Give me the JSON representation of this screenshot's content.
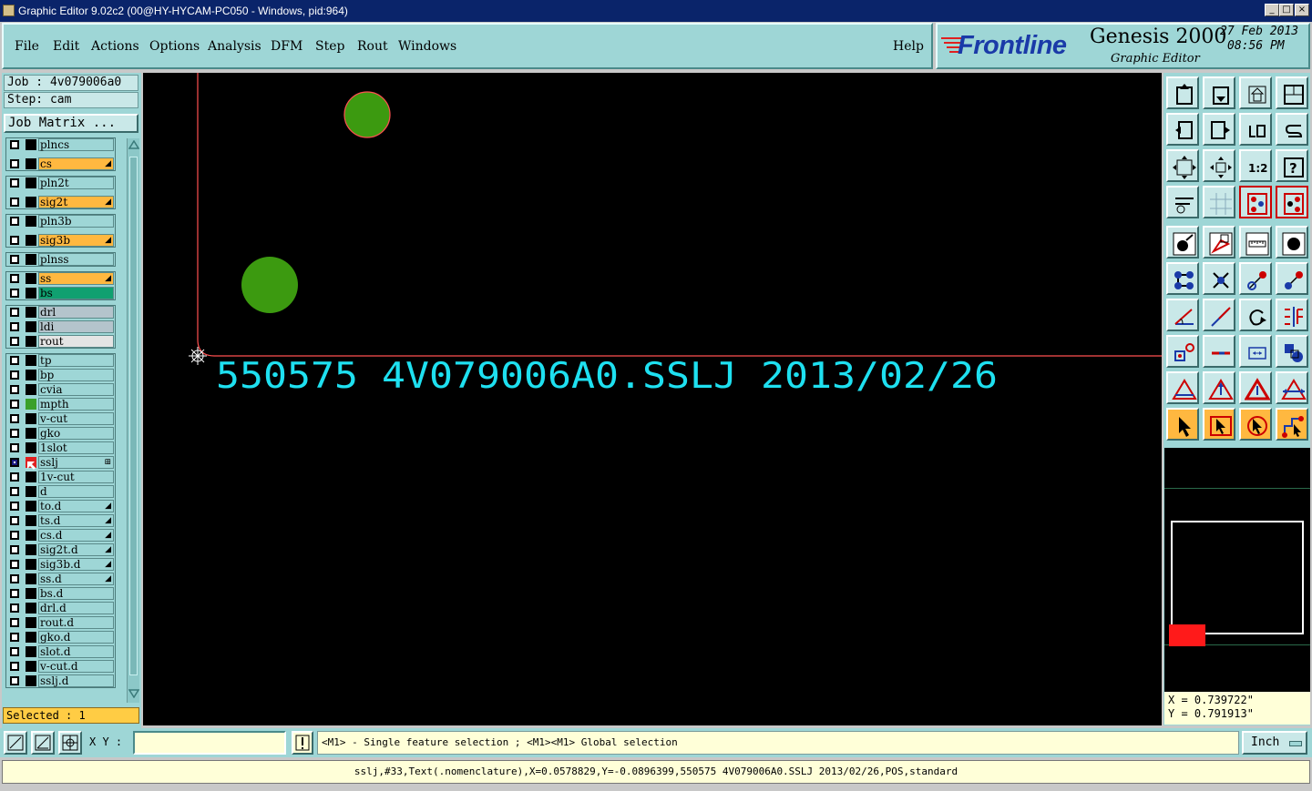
{
  "window": {
    "title": "Graphic Editor 9.02c2 (00@HY-HYCAM-PC050 - Windows, pid:964)",
    "minimize": "_",
    "maximize": "□",
    "close": "×"
  },
  "menu": {
    "items": [
      "File",
      "Edit",
      "Actions",
      "Options",
      "Analysis",
      "DFM",
      "Step",
      "Rout",
      "Windows"
    ],
    "help": "Help"
  },
  "brand": {
    "logo": "Frontline",
    "product": "Genesis 2000",
    "subtitle": "Graphic Editor",
    "date": "27 Feb 2013",
    "time": "08:56 PM"
  },
  "job": {
    "job_label": "Job : 4v079006a0",
    "step_label": "Step: cam",
    "matrix_button": "Job Matrix ..."
  },
  "layers": [
    {
      "name": "plncs",
      "bg": "#9ed6d6",
      "color": "#000000",
      "mark": ""
    },
    {
      "name": "cs",
      "bg": "#ffb840",
      "color": "#000000",
      "mark": "◢"
    },
    {
      "name": "pln2t",
      "bg": "#9ed6d6",
      "color": "#000000",
      "mark": ""
    },
    {
      "name": "sig2t",
      "bg": "#ffb840",
      "color": "#000000",
      "mark": "◢"
    },
    {
      "name": "pln3b",
      "bg": "#9ed6d6",
      "color": "#000000",
      "mark": ""
    },
    {
      "name": "sig3b",
      "bg": "#ffb840",
      "color": "#000000",
      "mark": "◢"
    },
    {
      "name": "plnss",
      "bg": "#9ed6d6",
      "color": "#000000",
      "mark": ""
    },
    {
      "name": "ss",
      "bg": "#ffb840",
      "color": "#000000",
      "mark": "◢"
    },
    {
      "name": "bs",
      "bg": "#10a070",
      "color": "#000000",
      "mark": ""
    },
    {
      "name": "drl",
      "bg": "#b4c4cc",
      "color": "#000000",
      "mark": ""
    },
    {
      "name": "ldi",
      "bg": "#b4c4cc",
      "color": "#000000",
      "mark": ""
    },
    {
      "name": "rout",
      "bg": "#e4e4e4",
      "color": "#000000",
      "mark": ""
    },
    {
      "name": "tp",
      "bg": "#9ed6d6",
      "color": "#000000",
      "mark": ""
    },
    {
      "name": "bp",
      "bg": "#9ed6d6",
      "color": "#000000",
      "mark": ""
    },
    {
      "name": "cvia",
      "bg": "#9ed6d6",
      "color": "#000000",
      "mark": ""
    },
    {
      "name": "mpth",
      "bg": "#9ed6d6",
      "color": "#3aa02a",
      "mark": ""
    },
    {
      "name": "v-cut",
      "bg": "#9ed6d6",
      "color": "#000000",
      "mark": ""
    },
    {
      "name": "gko",
      "bg": "#9ed6d6",
      "color": "#000000",
      "mark": ""
    },
    {
      "name": "1slot",
      "bg": "#9ed6d6",
      "color": "#000000",
      "mark": ""
    },
    {
      "name": "sslj",
      "bg": "#9ed6d6",
      "color": "#ffffff",
      "mark": "⊞"
    },
    {
      "name": "1v-cut",
      "bg": "#9ed6d6",
      "color": "#000000",
      "mark": ""
    },
    {
      "name": "d",
      "bg": "#9ed6d6",
      "color": "#000000",
      "mark": ""
    },
    {
      "name": "to.d",
      "bg": "#9ed6d6",
      "color": "#000000",
      "mark": "◢"
    },
    {
      "name": "ts.d",
      "bg": "#9ed6d6",
      "color": "#000000",
      "mark": "◢"
    },
    {
      "name": "cs.d",
      "bg": "#9ed6d6",
      "color": "#000000",
      "mark": "◢"
    },
    {
      "name": "sig2t.d",
      "bg": "#9ed6d6",
      "color": "#000000",
      "mark": "◢"
    },
    {
      "name": "sig3b.d",
      "bg": "#9ed6d6",
      "color": "#000000",
      "mark": "◢"
    },
    {
      "name": "ss.d",
      "bg": "#9ed6d6",
      "color": "#000000",
      "mark": "◢"
    },
    {
      "name": "bs.d",
      "bg": "#9ed6d6",
      "color": "#000000",
      "mark": ""
    },
    {
      "name": "drl.d",
      "bg": "#9ed6d6",
      "color": "#000000",
      "mark": ""
    },
    {
      "name": "rout.d",
      "bg": "#9ed6d6",
      "color": "#000000",
      "mark": ""
    },
    {
      "name": "gko.d",
      "bg": "#9ed6d6",
      "color": "#000000",
      "mark": ""
    },
    {
      "name": "slot.d",
      "bg": "#9ed6d6",
      "color": "#000000",
      "mark": ""
    },
    {
      "name": "v-cut.d",
      "bg": "#9ed6d6",
      "color": "#000000",
      "mark": ""
    },
    {
      "name": "sslj.d",
      "bg": "#9ed6d6",
      "color": "#000000",
      "mark": ""
    }
  ],
  "selection": {
    "label": "Selected : 1"
  },
  "canvas": {
    "text": "550575 4V079006A0.SSLJ 2013/02/26",
    "text_color": "#1ee0f0",
    "pad_color": "#3c9a10",
    "outline_color": "#ff5050"
  },
  "coords": {
    "x": "X = 0.739722\"",
    "y": "Y = 0.791913\""
  },
  "xy": {
    "label": "X Y :",
    "value": "",
    "hint": "<M1> - Single feature selection ; <M1><M1> Global selection",
    "units": "Inch"
  },
  "status": "sslj,#33,Text(.nomenclature),X=0.0578829,Y=-0.0896399,550575 4V079006A0.SSLJ 2013/02/26,POS,standard"
}
